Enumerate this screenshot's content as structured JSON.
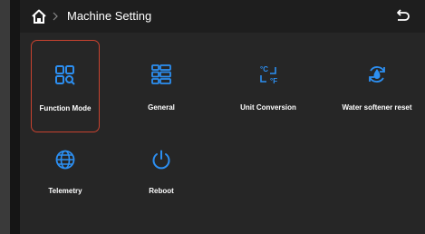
{
  "header": {
    "title": "Machine Setting",
    "home_icon": "home-icon",
    "separator_icon": "chevron-right-icon",
    "back_icon": "return-icon"
  },
  "menu": {
    "items": [
      {
        "label": "Function Mode",
        "icon": "function-mode-icon",
        "selected": true
      },
      {
        "label": "General",
        "icon": "list-icon",
        "selected": false
      },
      {
        "label": "Unit Conversion",
        "icon": "unit-conversion-icon",
        "selected": false
      },
      {
        "label": "Water softener reset",
        "icon": "water-softener-icon",
        "selected": false
      },
      {
        "label": "Telemetry",
        "icon": "globe-icon",
        "selected": false
      },
      {
        "label": "Reboot",
        "icon": "power-icon",
        "selected": false
      }
    ]
  },
  "colors": {
    "accent": "#2c8ff2",
    "selection_border": "#c8422f",
    "background": "#262626",
    "header_background": "#1e1e1e",
    "text": "#ffffff"
  }
}
